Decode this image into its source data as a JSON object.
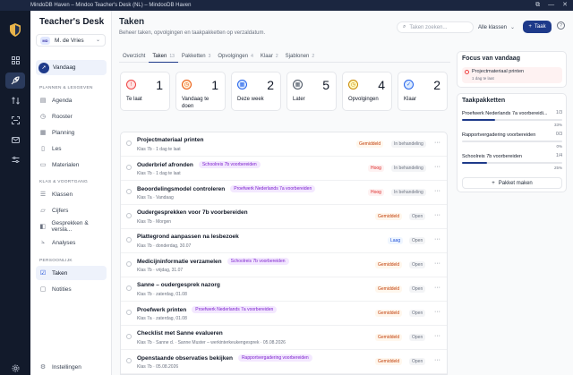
{
  "window": {
    "title": "MindoDB Haven – Mindoo Teacher's Desk (NL) – MindooDB Haven",
    "controls": [
      "⧉",
      "—",
      "✕"
    ]
  },
  "rail": {
    "icons": [
      "shield-logo",
      "grid-icon",
      "rocket-icon",
      "swap-icon",
      "scan-icon",
      "mail-icon",
      "sliders-icon",
      "settings-icon"
    ]
  },
  "sidebar": {
    "brand": "Teacher's Desk",
    "user": {
      "initials": "MD",
      "name": "M. de Vries"
    },
    "today": "Vandaag",
    "sections": [
      {
        "title": "PLANNEN & LESGEVEN",
        "items": [
          "Agenda",
          "Rooster",
          "Planning",
          "Les",
          "Materialen"
        ]
      },
      {
        "title": "KLAS & VOORTGANG",
        "items": [
          "Klassen",
          "Cijfers",
          "Gesprekken & versla...",
          "Analyses"
        ]
      },
      {
        "title": "PERSOONLIJK",
        "items": [
          "Taken",
          "Notities"
        ]
      }
    ],
    "settings": "Instellingen"
  },
  "header": {
    "title": "Taken",
    "subtitle": "Beheer taken, opvolgingen en taakpakketten op verzaldatum.",
    "search_placeholder": "Taken zoeken...",
    "class_select": "Alle klassen",
    "new_button": "Taak",
    "help": "?"
  },
  "tabs": [
    {
      "label": "Overzicht",
      "count": ""
    },
    {
      "label": "Taken",
      "count": "13"
    },
    {
      "label": "Pakketten",
      "count": "3"
    },
    {
      "label": "Opvolgingen",
      "count": "4"
    },
    {
      "label": "Klaar",
      "count": "2"
    },
    {
      "label": "Sjablonen",
      "count": "2"
    }
  ],
  "stats": [
    {
      "label": "Te laat",
      "value": "1",
      "icon": "alert-icon",
      "color": "#ef4444",
      "bg": "#fee2e2"
    },
    {
      "label": "Vandaag te doen",
      "value": "1",
      "icon": "clock-icon",
      "color": "#ea580c",
      "bg": "#ffedd5"
    },
    {
      "label": "Deze week",
      "value": "2",
      "icon": "calendar-icon",
      "color": "#2563eb",
      "bg": "#dbeafe"
    },
    {
      "label": "Later",
      "value": "5",
      "icon": "calendar-icon",
      "color": "#4b5563",
      "bg": "#f3f4f6"
    },
    {
      "label": "Opvolgingen",
      "value": "4",
      "icon": "clock-icon",
      "color": "#ca8a04",
      "bg": "#fef9c3"
    },
    {
      "label": "Klaar",
      "value": "2",
      "icon": "check-icon",
      "color": "#2563eb",
      "bg": "#dbeafe"
    }
  ],
  "tasks": [
    {
      "title": "Projectmateriaal printen",
      "tag": "",
      "sub": "Klas 7b · 1 dag te laat",
      "priority": "Gemiddeld",
      "prio_type": "mid",
      "status": "In behandeling"
    },
    {
      "title": "Ouderbrief afronden",
      "tag": "Schoolreis 7b voorbereiden",
      "sub": "Klas 7b · 1 dag te laat",
      "priority": "Hoog",
      "prio_type": "hoog",
      "status": "In behandeling"
    },
    {
      "title": "Beoordelingsmodel controleren",
      "tag": "Proefwerk Nederlands 7a voorbereiden",
      "sub": "Klas 7a · Vandaag",
      "priority": "Hoog",
      "prio_type": "hoog",
      "status": "In behandeling"
    },
    {
      "title": "Oudergesprekken voor 7b voorbereiden",
      "tag": "",
      "sub": "Klas 7b · Morgen",
      "priority": "Gemiddeld",
      "prio_type": "mid",
      "status": "Open"
    },
    {
      "title": "Plattegrond aanpassen na lesbezoek",
      "tag": "",
      "sub": "Klas 7b · donderdag, 30.07",
      "priority": "Laag",
      "prio_type": "laag",
      "status": "Open"
    },
    {
      "title": "Medicijninformatie verzamelen",
      "tag": "Schoolreis 7b voorbereiden",
      "sub": "Klas 7b · vrijdag, 31.07",
      "priority": "Gemiddeld",
      "prio_type": "mid",
      "status": "Open"
    },
    {
      "title": "Sanne – oudergesprek nazorg",
      "tag": "",
      "sub": "Klas 7b · zaterdag, 01.08",
      "priority": "Gemiddeld",
      "prio_type": "mid",
      "status": "Open"
    },
    {
      "title": "Proefwerk printen",
      "tag": "Proefwerk Nederlands 7a voorbereiden",
      "sub": "Klas 7a · zaterdag, 01.08",
      "priority": "Gemiddeld",
      "prio_type": "mid",
      "status": "Open"
    },
    {
      "title": "Checklist met Sanne evalueren",
      "tag": "",
      "sub": "Klas 7b · Sanne d. · Sanne Muster – werkinterkeukengesprek · 05.08.2026",
      "priority": "Gemiddeld",
      "prio_type": "mid",
      "status": "Open"
    },
    {
      "title": "Openstaande observaties bekijken",
      "tag": "Rapportvergadering voorbereiden",
      "sub": "Klas 7b · 05.08.2026",
      "priority": "Gemiddeld",
      "prio_type": "mid",
      "status": "Open"
    }
  ],
  "focus": {
    "title": "Focus van vandaag",
    "item": {
      "title": "Projectmateriaal printen",
      "sub": "1 dag te laat"
    }
  },
  "packages": {
    "title": "Taakpakketten",
    "items": [
      {
        "name": "Proefwerk Nederlands 7a voorbereidi...",
        "count": "1/3",
        "percent": "33%",
        "fraction": 0.33
      },
      {
        "name": "Rapportvergadering voorbereiden",
        "count": "0/3",
        "percent": "0%",
        "fraction": 0.0
      },
      {
        "name": "Schoolreis 7b voorbereiden",
        "count": "1/4",
        "percent": "25%",
        "fraction": 0.25
      }
    ],
    "button": "Pakket maken"
  }
}
